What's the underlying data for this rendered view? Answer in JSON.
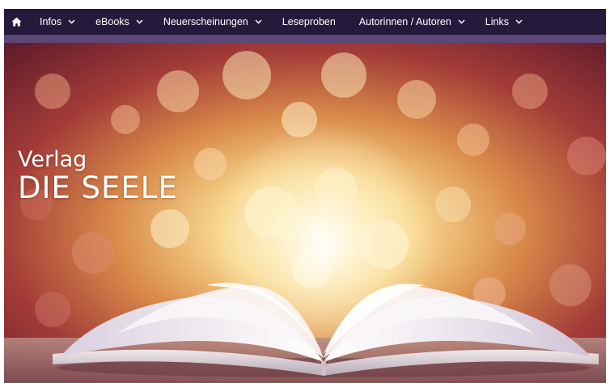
{
  "nav": {
    "home_icon": "home-icon",
    "items": [
      {
        "label": "Infos",
        "has_dropdown": true
      },
      {
        "label": "eBooks",
        "has_dropdown": true
      },
      {
        "label": "Neuerscheinungen",
        "has_dropdown": true
      },
      {
        "label": "Leseproben",
        "has_dropdown": false
      },
      {
        "label": "Autorinnen / Autoren",
        "has_dropdown": true
      },
      {
        "label": "Links",
        "has_dropdown": true
      }
    ]
  },
  "hero": {
    "title_line1": "Verlag",
    "title_line2": "DIE SEELE",
    "image": "open-book-bokeh-image"
  },
  "colors": {
    "nav_background": "#261a3c",
    "accent_bar": "#5b4778",
    "nav_text": "#ffffff"
  }
}
